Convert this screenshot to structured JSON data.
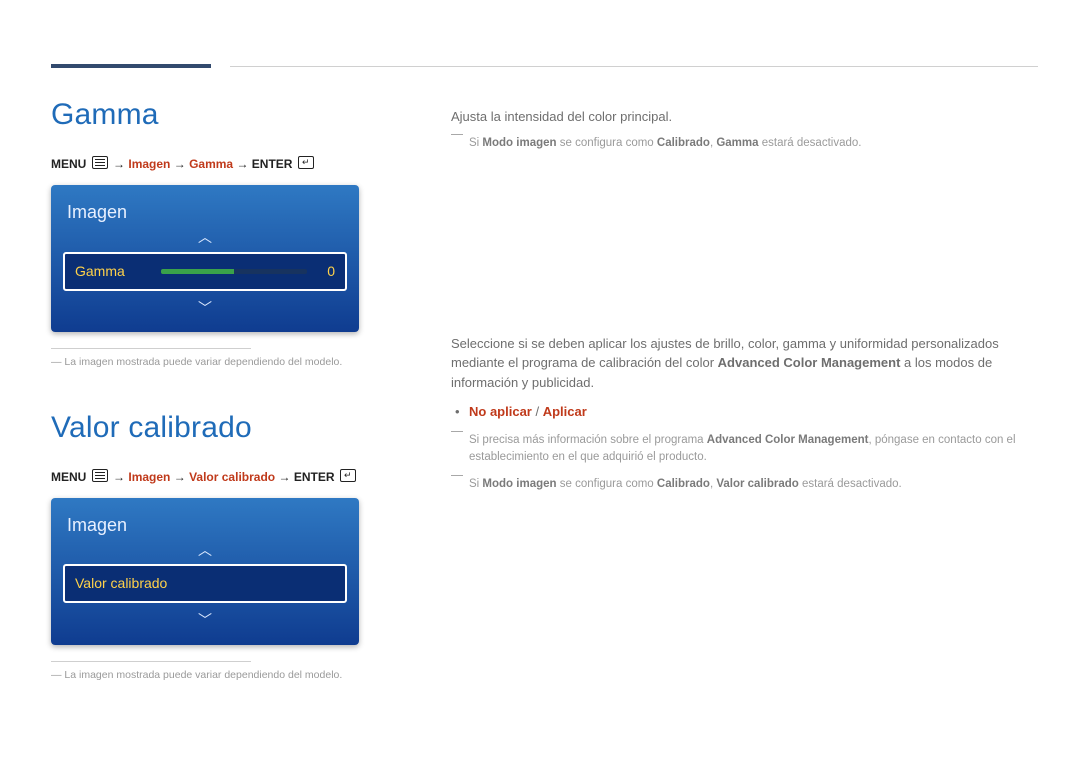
{
  "gamma": {
    "heading": "Gamma",
    "path": {
      "menu": "MENU",
      "seg1": "Imagen",
      "seg2": "Gamma",
      "enter": "ENTER"
    },
    "osd": {
      "panel_title": "Imagen",
      "row_label": "Gamma",
      "row_value": "0"
    },
    "footnote": "La imagen mostrada puede variar dependiendo del modelo.",
    "body": {
      "intro": "Ajusta la intensidad del color principal.",
      "note_pre": "Si ",
      "note_b1": "Modo imagen",
      "note_mid": " se configura como ",
      "note_b2": "Calibrado",
      "note_sep": ", ",
      "note_b3": "Gamma",
      "note_post": " estará desactivado."
    }
  },
  "calibrated": {
    "heading": "Valor calibrado",
    "path": {
      "menu": "MENU",
      "seg1": "Imagen",
      "seg2": "Valor calibrado",
      "enter": "ENTER"
    },
    "osd": {
      "panel_title": "Imagen",
      "row_label": "Valor calibrado"
    },
    "footnote": "La imagen mostrada puede variar dependiendo del modelo.",
    "body": {
      "intro_a": "Seleccione si se deben aplicar los ajustes de brillo, color, gamma y uniformidad personalizados mediante el programa de calibración del color ",
      "intro_strong": "Advanced Color Management",
      "intro_b": " a los modos de información y publicidad.",
      "opt1": "No aplicar",
      "opt_sep": " / ",
      "opt2": "Aplicar",
      "note1_pre": "Si precisa más información sobre el programa ",
      "note1_strong": "Advanced Color Management",
      "note1_post": ", póngase en contacto con el establecimiento en el que adquirió el producto.",
      "note2_pre": "Si ",
      "note2_b1": "Modo imagen",
      "note2_mid": " se configura como ",
      "note2_b2": "Calibrado",
      "note2_sep": ", ",
      "note2_b3": "Valor calibrado",
      "note2_post": " estará desactivado."
    }
  }
}
